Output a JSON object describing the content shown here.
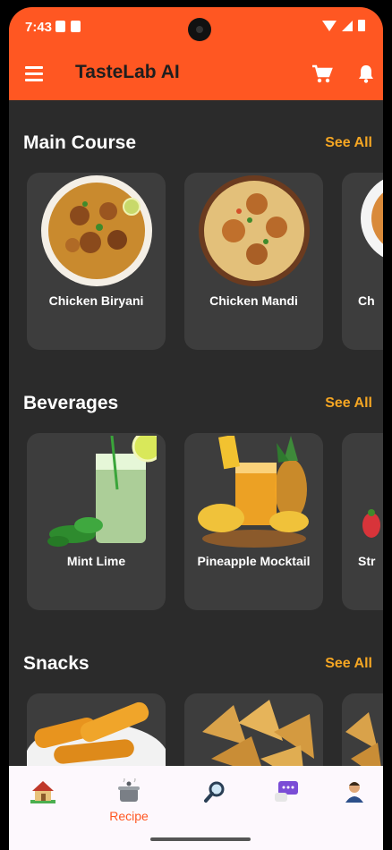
{
  "status_bar": {
    "time": "7:43"
  },
  "app_bar": {
    "title": "TasteLab AI"
  },
  "sections": [
    {
      "title": "Main Course",
      "see_all": "See All",
      "items": [
        {
          "name": "Chicken Biryani"
        },
        {
          "name": "Chicken Mandi"
        },
        {
          "name": "Ch"
        }
      ]
    },
    {
      "title": "Beverages",
      "see_all": "See All",
      "items": [
        {
          "name": "Mint Lime"
        },
        {
          "name": "Pineapple Mocktail"
        },
        {
          "name": "Str"
        }
      ]
    },
    {
      "title": "Snacks",
      "see_all": "See All",
      "items": [
        {
          "name": ""
        },
        {
          "name": ""
        },
        {
          "name": ""
        }
      ]
    }
  ],
  "bottom_nav": {
    "items": [
      {
        "icon": "home-icon",
        "label": ""
      },
      {
        "icon": "cooking-pot-icon",
        "label": "Recipe"
      },
      {
        "icon": "search-icon",
        "label": ""
      },
      {
        "icon": "chat-icon",
        "label": ""
      },
      {
        "icon": "profile-icon",
        "label": ""
      }
    ]
  },
  "colors": {
    "brand": "#ff5722",
    "accent": "#f5a623",
    "background": "#2b2b2b",
    "card": "#3d3d3d"
  }
}
